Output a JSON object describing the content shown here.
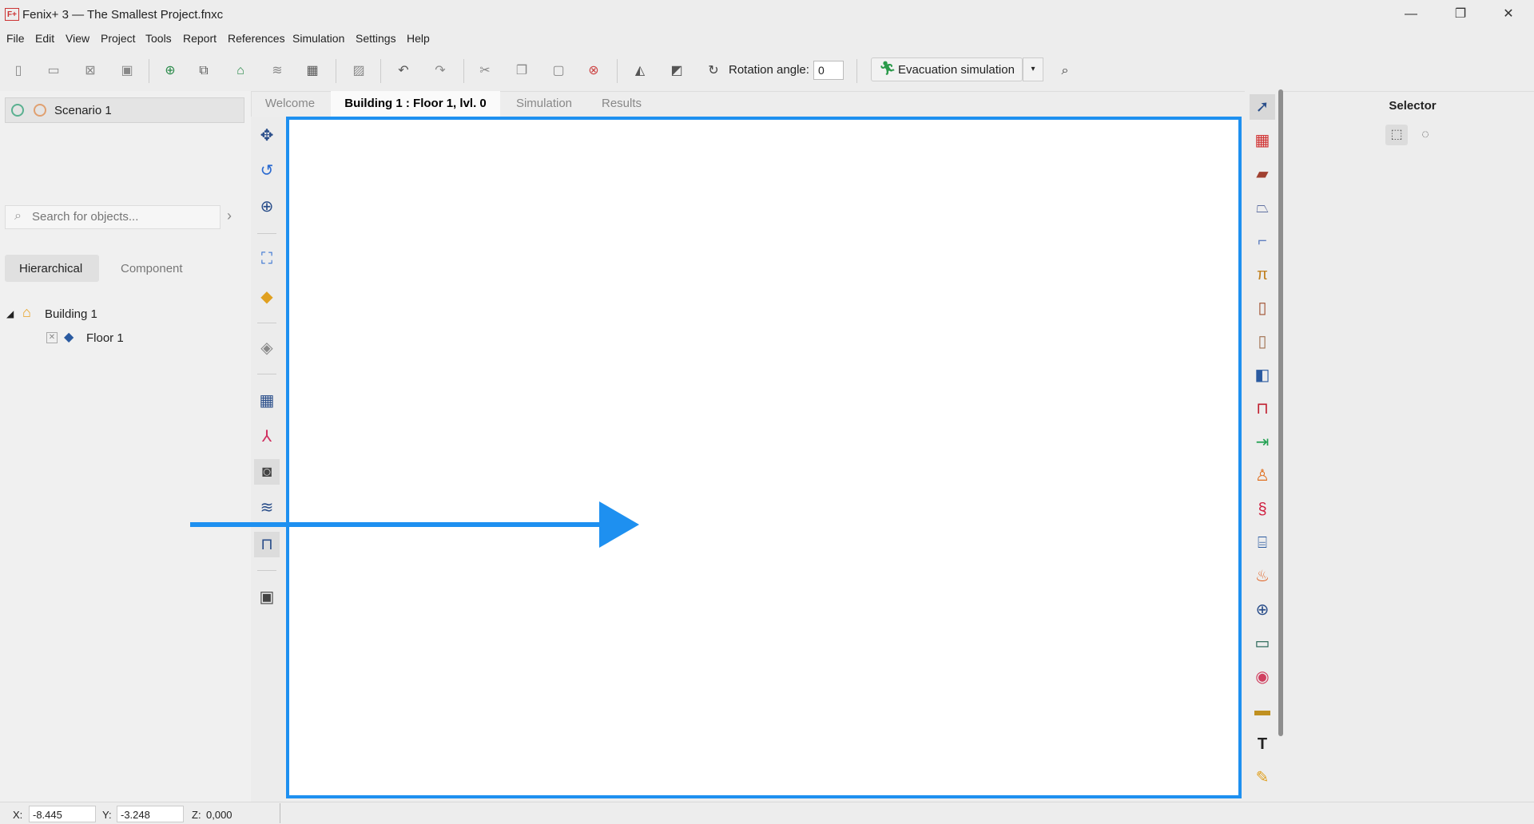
{
  "app": {
    "logo_text": "F+",
    "window_title": "Fenix+ 3 — The Smallest Project.fnxc",
    "minimize": "—",
    "restore": "❐",
    "close": "✕"
  },
  "menu": [
    "File",
    "Edit",
    "View",
    "Project",
    "Tools",
    "Report",
    "References",
    "Simulation",
    "Settings",
    "Help"
  ],
  "toolbar": {
    "rotation_label": "Rotation angle:",
    "rotation_value": "0",
    "evacuation_label": "Evacuation simulation"
  },
  "left_panel": {
    "scenario": "Scenario 1",
    "search_placeholder": "Search for objects...",
    "tabs": [
      "Hierarchical",
      "Component"
    ],
    "tree": [
      {
        "label": "Building 1"
      },
      {
        "label": "Floor 1"
      }
    ]
  },
  "view_tabs": [
    "Welcome",
    "Building 1 : Floor 1, lvl. 0",
    "Simulation",
    "Results"
  ],
  "right_panel": {
    "title": "Selector"
  },
  "status": {
    "x_label": "X:",
    "x_value": "-8.445",
    "y_label": "Y:",
    "y_value": "-3.248",
    "z_label": "Z:",
    "z_value": "0,000"
  },
  "colors": {
    "accent": "#1e90f0",
    "canvas_bg": "#ffffff"
  }
}
